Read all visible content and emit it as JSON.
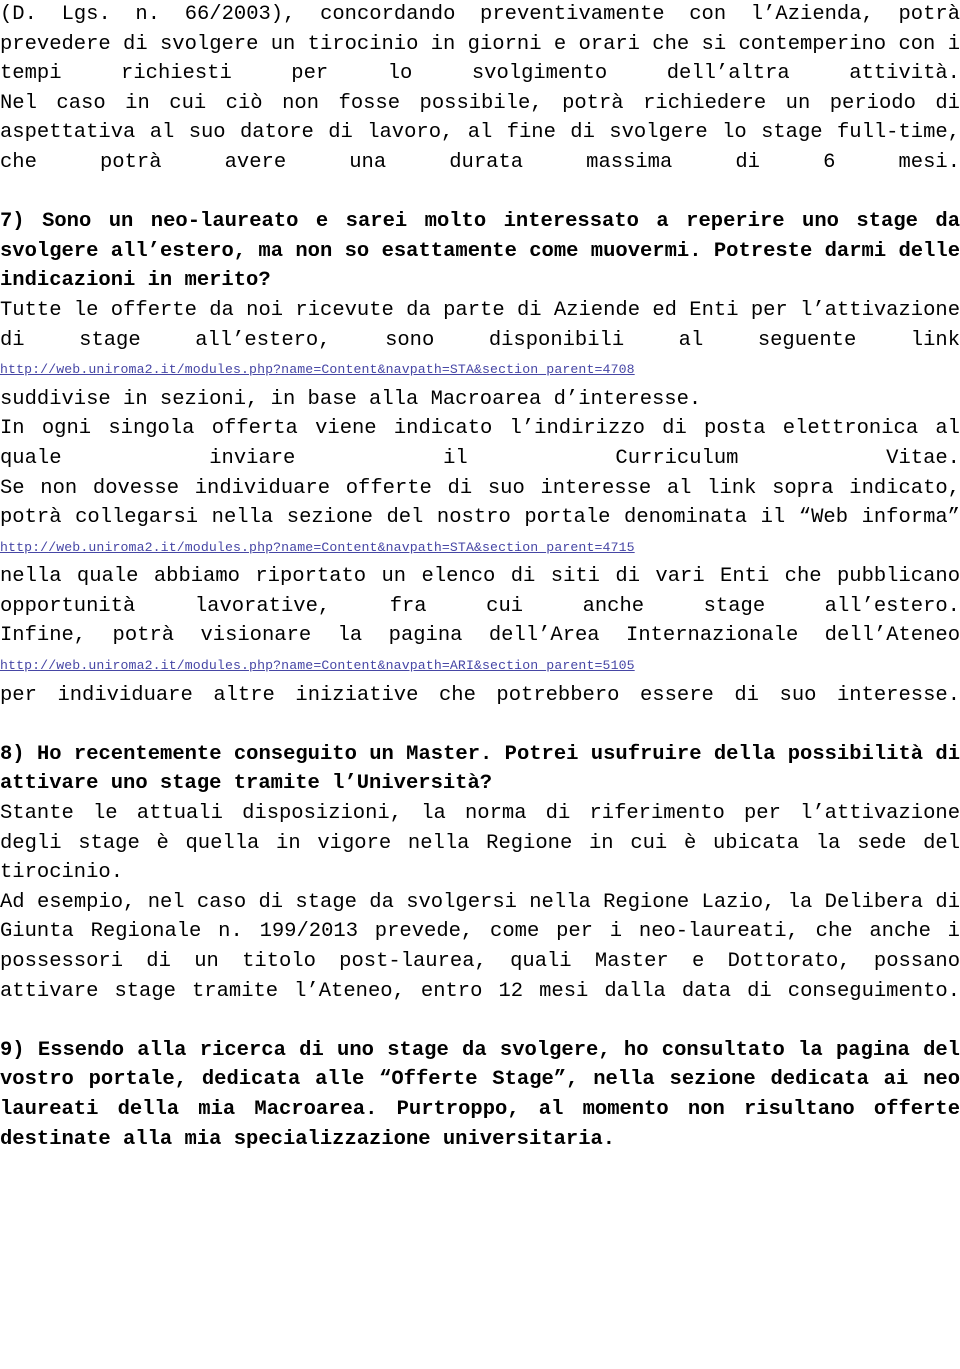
{
  "document": {
    "language": "it",
    "link_color": "#4646a5",
    "text_color": "#000000",
    "background_color": "#ffffff"
  },
  "blocks": {
    "continuation_paragraph_1": "(D. Lgs. n. 66/2003), concordando preventivamente con l’Azienda, potrà prevedere di svolgere un tirocinio in giorni e orari che si contemperino con i tempi richiesti per lo svolgimento dell’altra attività.",
    "continuation_paragraph_2": "Nel caso in cui ciò non fosse possibile, potrà richiedere un periodo di aspettativa al suo datore di lavoro, al fine di svolgere lo stage full-time, che potrà avere una durata massima di 6 mesi.",
    "q7_question": "7) Sono un neo-laureato e sarei molto interessato a reperire uno stage da svolgere all’estero, ma non so esattamente come muovermi. Potreste darmi delle indicazioni in merito?",
    "q7_answer_1": "Tutte le offerte da noi ricevute da parte di Aziende ed Enti per l’attivazione di stage all’estero, sono disponibili al seguente link",
    "q7_link_1": "http://web.uniroma2.it/modules.php?name=Content&navpath=STA&section_parent=4708",
    "q7_answer_2": "suddivise in sezioni, in base alla Macroarea d’interesse.",
    "q7_answer_3": "In ogni singola offerta viene indicato l’indirizzo di posta elettronica al quale inviare il Curriculum Vitae.",
    "q7_answer_4": "Se non dovesse individuare offerte di suo interesse al link sopra indicato, potrà collegarsi nella sezione del nostro portale denominata il “Web informa”",
    "q7_link_2": "http://web.uniroma2.it/modules.php?name=Content&navpath=STA&section_parent=4715",
    "q7_answer_5": "nella quale abbiamo riportato un elenco di siti di vari Enti che pubblicano opportunità lavorative, fra cui anche stage all’estero.",
    "q7_answer_6": "Infine, potrà visionare la pagina dell’Area Internazionale dell’Ateneo",
    "q7_link_3": "http://web.uniroma2.it/modules.php?name=Content&navpath=ARI&section_parent=5105",
    "q7_answer_7": "per individuare altre iniziative che potrebbero essere di suo interesse.",
    "q8_question": "8) Ho recentemente conseguito un Master. Potrei usufruire della possibilità di attivare uno stage tramite l’Università?",
    "q8_answer_1": "Stante le attuali disposizioni, la norma di riferimento per l’attivazione degli stage è quella in vigore nella Regione in cui è ubicata la sede del tirocinio.",
    "q8_answer_2": "Ad esempio, nel caso di stage da svolgersi nella Regione Lazio, la Delibera di Giunta Regionale n. 199/2013 prevede, come per i neo-laureati, che anche i possessori di un titolo post-laurea, quali Master e Dottorato, possano attivare stage tramite l’Ateneo, entro 12 mesi dalla data di conseguimento.",
    "q9_question": "9) Essendo alla ricerca di uno stage da svolgere, ho consultato la pagina del vostro portale, dedicata alle “Offerte Stage”, nella sezione dedicata ai neo laureati della mia Macroarea. Purtroppo, al momento non risultano offerte destinate alla mia specializzazione universitaria."
  }
}
